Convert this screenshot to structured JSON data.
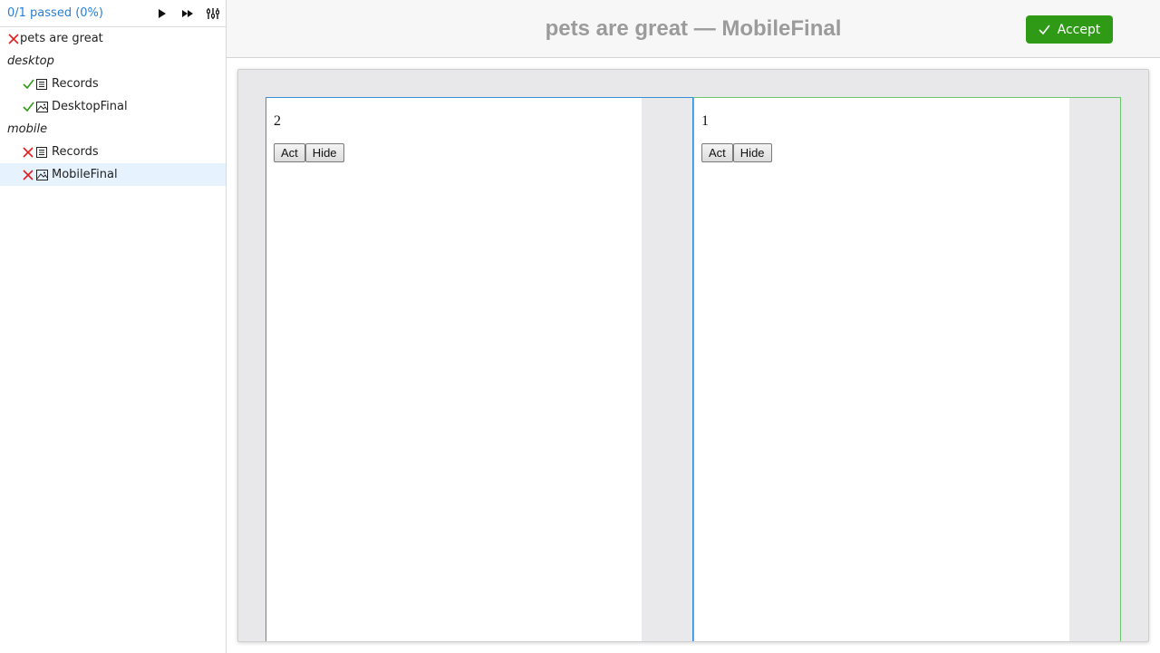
{
  "sidebar": {
    "summary": "0/1 passed (0%)",
    "controls": [
      "play-icon",
      "fast-forward-icon",
      "settings-sliders-icon"
    ],
    "tree": [
      {
        "label": "pets are great",
        "status": "fail",
        "type": "test"
      },
      {
        "label": "desktop",
        "type": "group"
      },
      {
        "label": "Records",
        "status": "pass",
        "type": "records"
      },
      {
        "label": "DesktopFinal",
        "status": "pass",
        "type": "image"
      },
      {
        "label": "mobile",
        "type": "group"
      },
      {
        "label": "Records",
        "status": "fail",
        "type": "records"
      },
      {
        "label": "MobileFinal",
        "status": "fail",
        "type": "image",
        "selected": true
      }
    ]
  },
  "header": {
    "title": "pets are great — MobileFinal",
    "accept_label": "Accept"
  },
  "viewer": {
    "left": {
      "value": "2",
      "act_label": "Act",
      "hide_label": "Hide"
    },
    "right": {
      "value": "1",
      "act_label": "Act",
      "hide_label": "Hide"
    }
  },
  "colors": {
    "link": "#2a7fd4",
    "pass": "#2e9a16",
    "fail": "#e02020",
    "accept": "#2e9a16",
    "selected_row": "#e6f2fd",
    "left_border": "#3a8ed6",
    "right_border": "#6cc66c"
  }
}
